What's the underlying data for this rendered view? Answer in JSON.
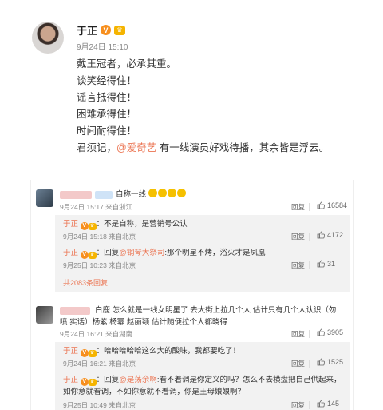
{
  "post": {
    "author": "于正",
    "time": "9月24日 15:10",
    "lines": [
      "戴王冠者，必承其重。",
      "谈笑经得住！",
      "谣言抵得住！",
      "困难承得住！",
      "时间耐得住！"
    ],
    "last_line_prefix": "君须记，",
    "last_line_mention": "@爱奇艺",
    "last_line_suffix": " 有一线演员好戏待播，其余皆是浮云。"
  },
  "comments": [
    {
      "text": "自称一线",
      "time": "9月24日 15:17 来自浙江",
      "reply_label": "回复",
      "likes": "16584",
      "sub_replies": [
        {
          "author": "于正",
          "text": "：不是自称，是营销号公认",
          "time": "9月24日 15:18 来自北京",
          "reply_label": "回复",
          "likes": "4172"
        },
        {
          "author": "于正",
          "prefix": "：回复",
          "mention": "@钢琴大祭司",
          "text": ":那个明星不烤，浴火才是凤凰",
          "time": "9月25日 10:23 来自北京",
          "reply_label": "回复",
          "likes": "31"
        }
      ],
      "more_replies": "共2083条回复"
    },
    {
      "text": "白鹿 怎么就是一线女明星了 去大街上拉几个人 估计只有几个人认识（勿喷 实话）杨紫 杨幂 赵丽颖 估计随便拉个人都晓得",
      "time": "9月24日 16:21 来自湖南",
      "reply_label": "回复",
      "likes": "3905",
      "sub_replies": [
        {
          "author": "于正",
          "text": "：哈哈哈哈哈这么大的酸味，我都要吃了！",
          "time": "9月24日 16:21 来自北京",
          "reply_label": "回复",
          "likes": "1525"
        },
        {
          "author": "于正",
          "prefix": "：回复",
          "mention": "@是荡余啊",
          "text": ":看不着调是你定义的吗？怎么不去横盘把自己供起来，如你意就看调，不如你意就不着调，你是王母娘娘啊？",
          "time": "9月25日 10:49 来自北京",
          "reply_label": "回复",
          "likes": "145"
        }
      ]
    }
  ]
}
